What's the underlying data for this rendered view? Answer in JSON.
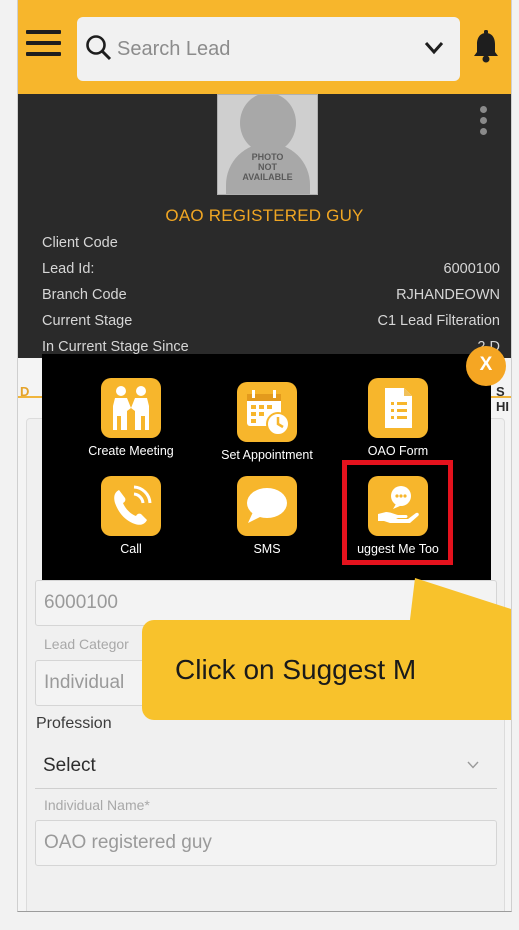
{
  "header": {
    "search_placeholder": "Search Lead"
  },
  "profile": {
    "photo_text": "PHOTO NOT AVAILABLE",
    "name": "OAO REGISTERED GUY",
    "rows": [
      {
        "label": "Client Code",
        "value": ""
      },
      {
        "label": "Lead Id:",
        "value": "6000100"
      },
      {
        "label": "Branch Code",
        "value": "RJHANDEOWN"
      },
      {
        "label": "Current Stage",
        "value": "C1 Lead Filteration"
      },
      {
        "label": "In Current Stage Since",
        "value": "2 D"
      }
    ]
  },
  "tabs": {
    "left": "D",
    "right": "S HI"
  },
  "form": {
    "lead_id_value": "6000100",
    "lead_category_label": "Lead Categor",
    "lead_category_value": "Individual",
    "profession_label": "Profession",
    "profession_value": "Select",
    "individual_name_label": "Individual Name*",
    "individual_name_value": "OAO registered guy"
  },
  "modal": {
    "close_label": "X",
    "actions": [
      {
        "label": "Create Meeting",
        "icon": "handshake-icon"
      },
      {
        "label": "Set Appointment",
        "icon": "calendar-clock-icon"
      },
      {
        "label": "OAO Form",
        "icon": "form-document-icon"
      },
      {
        "label": "Call",
        "icon": "phone-icon"
      },
      {
        "label": "SMS",
        "icon": "chat-bubble-icon"
      },
      {
        "label": "uggest Me Too",
        "icon": "hand-chat-icon"
      }
    ]
  },
  "callout": {
    "text": "Click on Suggest M"
  },
  "colors": {
    "accent": "#f7b62c",
    "highlight": "#e5121d",
    "header_bg": "#2a2a2a"
  }
}
